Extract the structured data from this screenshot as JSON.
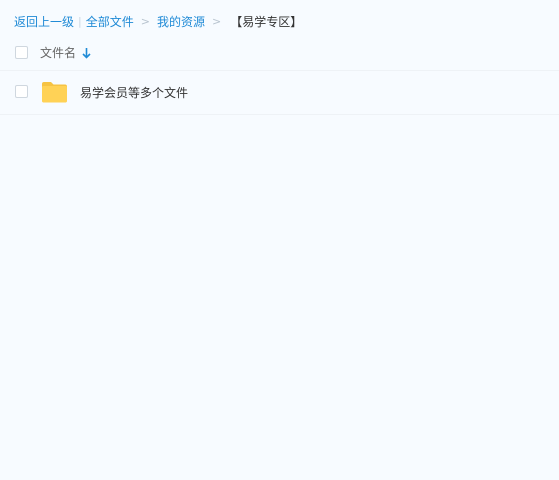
{
  "breadcrumb": {
    "back_label": "返回上一级",
    "separator_bar": "|",
    "all_files_label": "全部文件",
    "arrow": ">",
    "my_resources_label": "我的资源",
    "current_label": "【易学专区】"
  },
  "table": {
    "header_name": "文件名",
    "sort_direction": "descending",
    "rows": [
      {
        "name": "易学会员等多个文件",
        "type": "folder"
      }
    ]
  },
  "colors": {
    "background": "#f7fbff",
    "link": "#1f8ad6",
    "folder": "#ffd256"
  }
}
